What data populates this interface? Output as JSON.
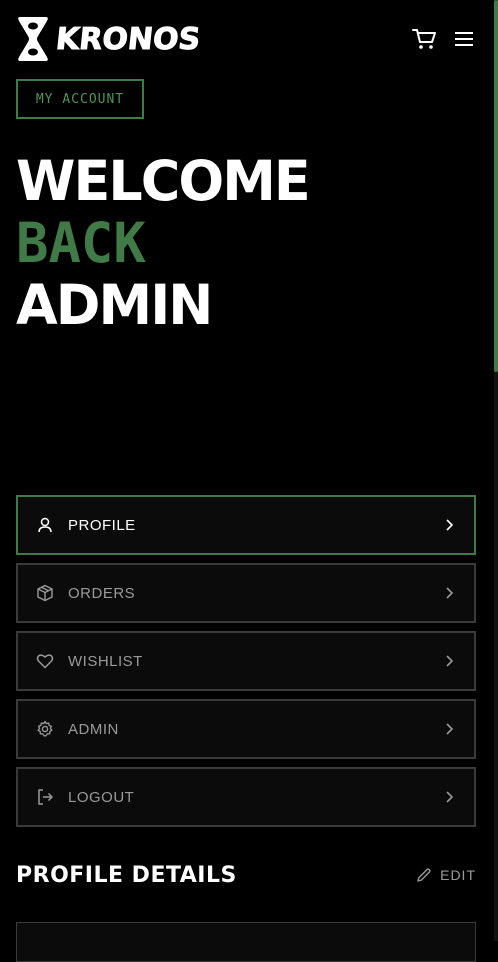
{
  "brand": {
    "name": "KRONOS"
  },
  "header": {
    "cart_icon": "cart-icon",
    "menu_icon": "hamburger-menu-icon"
  },
  "badge": {
    "label": "MY ACCOUNT"
  },
  "hero": {
    "line1": "WELCOME",
    "line2": "BACK",
    "line3": "ADMIN"
  },
  "nav": {
    "items": [
      {
        "label": "PROFILE",
        "icon": "user-icon",
        "active": true
      },
      {
        "label": "ORDERS",
        "icon": "package-icon",
        "active": false
      },
      {
        "label": "WISHLIST",
        "icon": "heart-icon",
        "active": false
      },
      {
        "label": "ADMIN",
        "icon": "gear-icon",
        "active": false
      },
      {
        "label": "LOGOUT",
        "icon": "logout-icon",
        "active": false
      }
    ]
  },
  "profile_details": {
    "title": "PROFILE DETAILS",
    "edit_label": "EDIT"
  },
  "colors": {
    "accent": "#3f7a47",
    "background": "#000000",
    "border": "#3a3a3a"
  }
}
